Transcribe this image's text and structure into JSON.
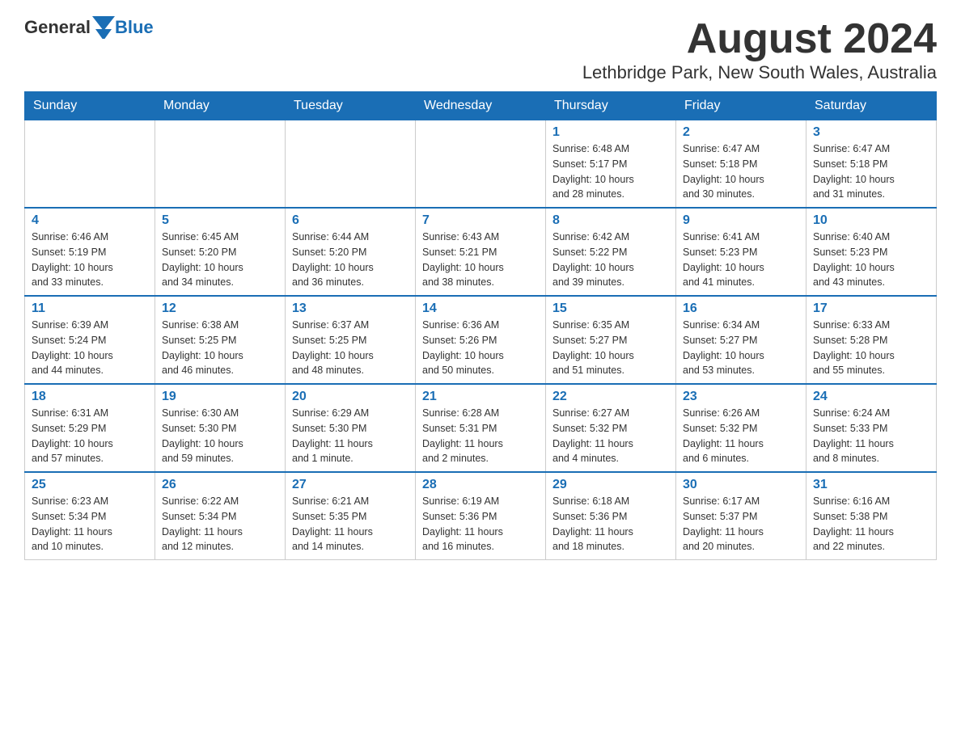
{
  "header": {
    "logo_general": "General",
    "logo_blue": "Blue",
    "month_title": "August 2024",
    "location": "Lethbridge Park, New South Wales, Australia"
  },
  "days_of_week": [
    "Sunday",
    "Monday",
    "Tuesday",
    "Wednesday",
    "Thursday",
    "Friday",
    "Saturday"
  ],
  "weeks": [
    [
      {
        "day": "",
        "info": ""
      },
      {
        "day": "",
        "info": ""
      },
      {
        "day": "",
        "info": ""
      },
      {
        "day": "",
        "info": ""
      },
      {
        "day": "1",
        "info": "Sunrise: 6:48 AM\nSunset: 5:17 PM\nDaylight: 10 hours\nand 28 minutes."
      },
      {
        "day": "2",
        "info": "Sunrise: 6:47 AM\nSunset: 5:18 PM\nDaylight: 10 hours\nand 30 minutes."
      },
      {
        "day": "3",
        "info": "Sunrise: 6:47 AM\nSunset: 5:18 PM\nDaylight: 10 hours\nand 31 minutes."
      }
    ],
    [
      {
        "day": "4",
        "info": "Sunrise: 6:46 AM\nSunset: 5:19 PM\nDaylight: 10 hours\nand 33 minutes."
      },
      {
        "day": "5",
        "info": "Sunrise: 6:45 AM\nSunset: 5:20 PM\nDaylight: 10 hours\nand 34 minutes."
      },
      {
        "day": "6",
        "info": "Sunrise: 6:44 AM\nSunset: 5:20 PM\nDaylight: 10 hours\nand 36 minutes."
      },
      {
        "day": "7",
        "info": "Sunrise: 6:43 AM\nSunset: 5:21 PM\nDaylight: 10 hours\nand 38 minutes."
      },
      {
        "day": "8",
        "info": "Sunrise: 6:42 AM\nSunset: 5:22 PM\nDaylight: 10 hours\nand 39 minutes."
      },
      {
        "day": "9",
        "info": "Sunrise: 6:41 AM\nSunset: 5:23 PM\nDaylight: 10 hours\nand 41 minutes."
      },
      {
        "day": "10",
        "info": "Sunrise: 6:40 AM\nSunset: 5:23 PM\nDaylight: 10 hours\nand 43 minutes."
      }
    ],
    [
      {
        "day": "11",
        "info": "Sunrise: 6:39 AM\nSunset: 5:24 PM\nDaylight: 10 hours\nand 44 minutes."
      },
      {
        "day": "12",
        "info": "Sunrise: 6:38 AM\nSunset: 5:25 PM\nDaylight: 10 hours\nand 46 minutes."
      },
      {
        "day": "13",
        "info": "Sunrise: 6:37 AM\nSunset: 5:25 PM\nDaylight: 10 hours\nand 48 minutes."
      },
      {
        "day": "14",
        "info": "Sunrise: 6:36 AM\nSunset: 5:26 PM\nDaylight: 10 hours\nand 50 minutes."
      },
      {
        "day": "15",
        "info": "Sunrise: 6:35 AM\nSunset: 5:27 PM\nDaylight: 10 hours\nand 51 minutes."
      },
      {
        "day": "16",
        "info": "Sunrise: 6:34 AM\nSunset: 5:27 PM\nDaylight: 10 hours\nand 53 minutes."
      },
      {
        "day": "17",
        "info": "Sunrise: 6:33 AM\nSunset: 5:28 PM\nDaylight: 10 hours\nand 55 minutes."
      }
    ],
    [
      {
        "day": "18",
        "info": "Sunrise: 6:31 AM\nSunset: 5:29 PM\nDaylight: 10 hours\nand 57 minutes."
      },
      {
        "day": "19",
        "info": "Sunrise: 6:30 AM\nSunset: 5:30 PM\nDaylight: 10 hours\nand 59 minutes."
      },
      {
        "day": "20",
        "info": "Sunrise: 6:29 AM\nSunset: 5:30 PM\nDaylight: 11 hours\nand 1 minute."
      },
      {
        "day": "21",
        "info": "Sunrise: 6:28 AM\nSunset: 5:31 PM\nDaylight: 11 hours\nand 2 minutes."
      },
      {
        "day": "22",
        "info": "Sunrise: 6:27 AM\nSunset: 5:32 PM\nDaylight: 11 hours\nand 4 minutes."
      },
      {
        "day": "23",
        "info": "Sunrise: 6:26 AM\nSunset: 5:32 PM\nDaylight: 11 hours\nand 6 minutes."
      },
      {
        "day": "24",
        "info": "Sunrise: 6:24 AM\nSunset: 5:33 PM\nDaylight: 11 hours\nand 8 minutes."
      }
    ],
    [
      {
        "day": "25",
        "info": "Sunrise: 6:23 AM\nSunset: 5:34 PM\nDaylight: 11 hours\nand 10 minutes."
      },
      {
        "day": "26",
        "info": "Sunrise: 6:22 AM\nSunset: 5:34 PM\nDaylight: 11 hours\nand 12 minutes."
      },
      {
        "day": "27",
        "info": "Sunrise: 6:21 AM\nSunset: 5:35 PM\nDaylight: 11 hours\nand 14 minutes."
      },
      {
        "day": "28",
        "info": "Sunrise: 6:19 AM\nSunset: 5:36 PM\nDaylight: 11 hours\nand 16 minutes."
      },
      {
        "day": "29",
        "info": "Sunrise: 6:18 AM\nSunset: 5:36 PM\nDaylight: 11 hours\nand 18 minutes."
      },
      {
        "day": "30",
        "info": "Sunrise: 6:17 AM\nSunset: 5:37 PM\nDaylight: 11 hours\nand 20 minutes."
      },
      {
        "day": "31",
        "info": "Sunrise: 6:16 AM\nSunset: 5:38 PM\nDaylight: 11 hours\nand 22 minutes."
      }
    ]
  ]
}
